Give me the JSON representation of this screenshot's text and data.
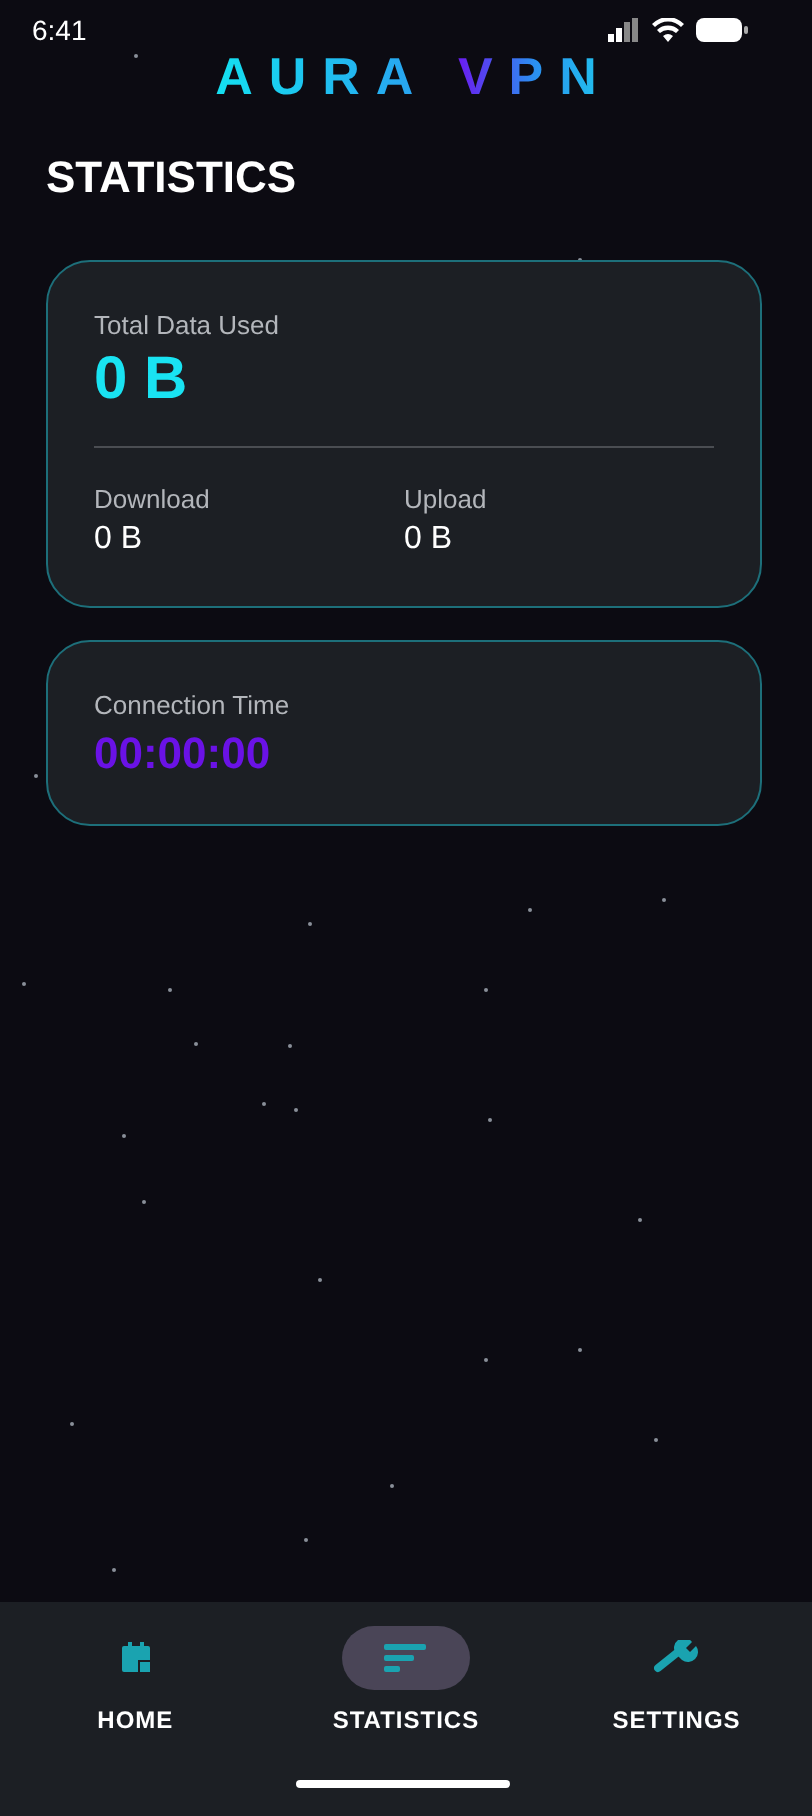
{
  "status_bar": {
    "time": "6:41"
  },
  "app_title": {
    "first": "AURA",
    "second": "VPN"
  },
  "page_title": "STATISTICS",
  "total_card": {
    "label": "Total Data Used",
    "value": "0 B",
    "stats": [
      {
        "label": "Download",
        "value": "0 B"
      },
      {
        "label": "Upload",
        "value": "0 B"
      }
    ]
  },
  "time_card": {
    "label": "Connection Time",
    "value": "00:00:00"
  },
  "nav": [
    {
      "label": "HOME",
      "selected": false
    },
    {
      "label": "STATISTICS",
      "selected": true
    },
    {
      "label": "SETTINGS",
      "selected": false
    }
  ]
}
